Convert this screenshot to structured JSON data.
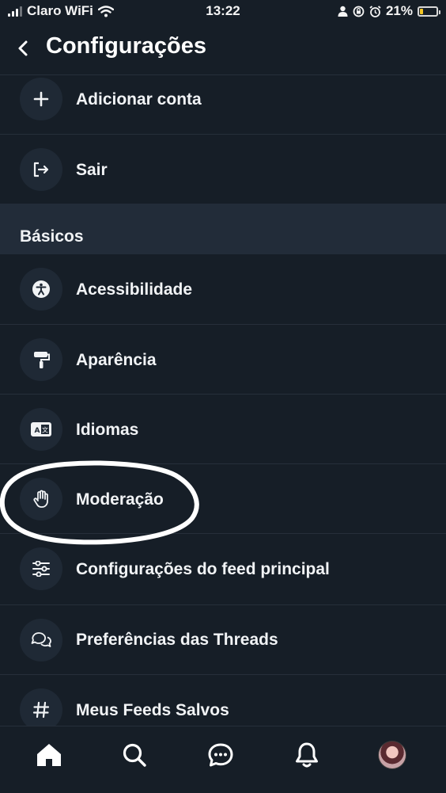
{
  "status_bar": {
    "carrier": "Claro WiFi",
    "time": "13:22",
    "battery_percent": "21%",
    "battery_level": 0.21,
    "battery_color": "#f3c623",
    "icons": [
      "signal-icon",
      "wifi-icon",
      "person-icon",
      "orientation-lock-icon",
      "alarm-icon",
      "battery-icon"
    ]
  },
  "header": {
    "title": "Configurações",
    "back_icon": "chevron-left-icon"
  },
  "account_items": [
    {
      "label": "Adicionar conta",
      "icon": "plus-icon"
    },
    {
      "label": "Sair",
      "icon": "logout-icon"
    }
  ],
  "section": {
    "title": "Básicos"
  },
  "basic_items": [
    {
      "label": "Acessibilidade",
      "icon": "accessibility-icon"
    },
    {
      "label": "Aparência",
      "icon": "paint-roller-icon"
    },
    {
      "label": "Idiomas",
      "icon": "language-icon"
    },
    {
      "label": "Moderação",
      "icon": "hand-icon"
    },
    {
      "label": "Configurações do feed principal",
      "icon": "sliders-icon"
    },
    {
      "label": "Preferências das Threads",
      "icon": "chat-bubbles-icon"
    },
    {
      "label": "Meus Feeds Salvos",
      "icon": "hashtag-icon"
    }
  ],
  "bottom_nav": [
    "home-icon",
    "search-icon",
    "chat-icon",
    "bell-icon",
    "avatar"
  ],
  "colors": {
    "background": "#161e27",
    "section_background": "#222c39",
    "icon_circle": "#1f2935",
    "divider": "#262f3a",
    "text": "#f1f3f5",
    "annotation": "#ffffff"
  }
}
